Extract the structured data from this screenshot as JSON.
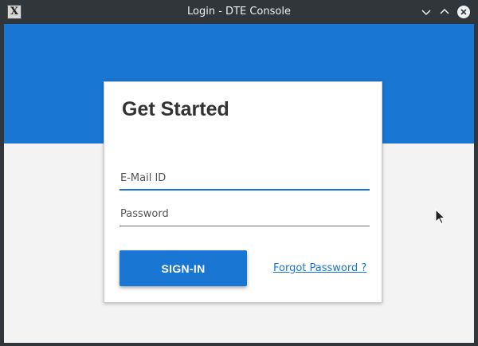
{
  "window": {
    "title": "Login - DTE Console",
    "app_icon_glyph": "X",
    "controls": [
      "minimize",
      "maximize",
      "close"
    ]
  },
  "login": {
    "heading": "Get Started",
    "email": {
      "placeholder": "E-Mail ID",
      "value": ""
    },
    "password": {
      "placeholder": "Password",
      "value": ""
    },
    "signin_label": "SIGN-IN",
    "forgot_label": "Forgot Password ?"
  },
  "colors": {
    "primary": "#1976d2",
    "background": "#f3f3f3",
    "card": "#ffffff",
    "titlebar": "#31363b"
  },
  "icons": {
    "app": "x-app-icon",
    "minimize": "chevron-down-icon",
    "maximize": "chevron-up-icon",
    "close": "close-icon",
    "cursor": "mouse-pointer-icon"
  }
}
